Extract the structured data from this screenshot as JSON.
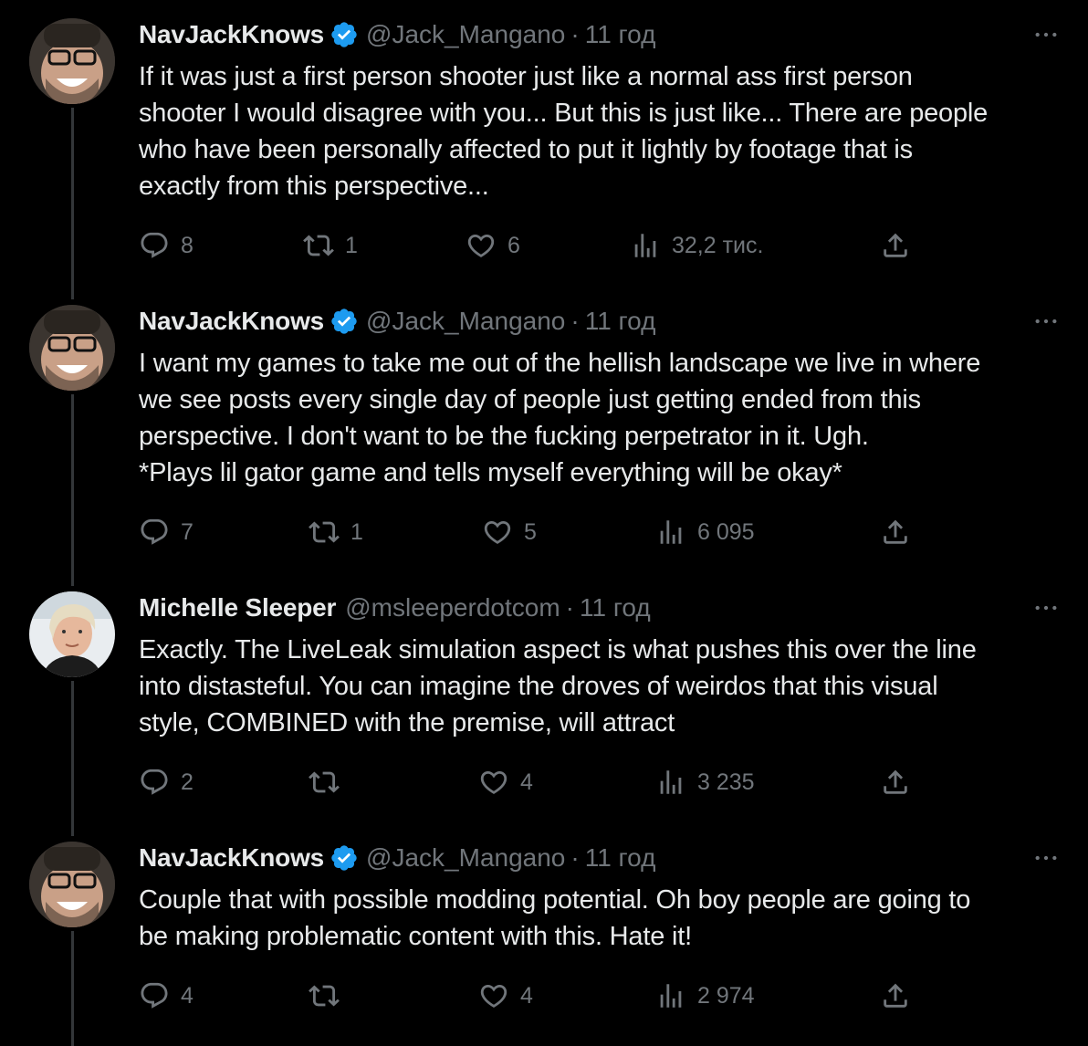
{
  "tweets": [
    {
      "name": "NavJackKnows",
      "verified": true,
      "handle": "@Jack_Mangano",
      "separator": "·",
      "time": "11 год",
      "text": "If it was just a first person shooter just like a normal ass first person\nshooter I would disagree with you... But this is just like... There are people\nwho have been personally affected to put it lightly by footage that is\nexactly from this perspective...",
      "replies": "8",
      "retweets": "1",
      "likes": "6",
      "views": "32,2 тис.",
      "avatar": "avatar-navjack"
    },
    {
      "name": "NavJackKnows",
      "verified": true,
      "handle": "@Jack_Mangano",
      "separator": "·",
      "time": "11 год",
      "text": "I want my games to take me out of the hellish landscape we live in where\nwe see posts every single day of people just getting ended from this\nperspective. I don't want to be the fucking perpetrator in it. Ugh.\n*Plays lil gator game and tells myself everything will be okay*",
      "replies": "7",
      "retweets": "1",
      "likes": "5",
      "views": "6 095",
      "avatar": "avatar-navjack"
    },
    {
      "name": "Michelle Sleeper",
      "verified": false,
      "handle": "@msleeperdotcom",
      "separator": "·",
      "time": "11 год",
      "text": "Exactly. The LiveLeak simulation aspect is what pushes this over the line\ninto distasteful. You can imagine the droves of weirdos that this visual\nstyle, COMBINED with the premise, will attract",
      "replies": "2",
      "retweets": "",
      "likes": "4",
      "views": "3 235",
      "avatar": "avatar-michelle"
    },
    {
      "name": "NavJackKnows",
      "verified": true,
      "handle": "@Jack_Mangano",
      "separator": "·",
      "time": "11 год",
      "text": "Couple that with possible modding potential. Oh boy people are going to\nbe making problematic content with this. Hate it!",
      "replies": "4",
      "retweets": "",
      "likes": "4",
      "views": "2 974",
      "avatar": "avatar-navjack"
    }
  ],
  "colors": {
    "background": "#000000",
    "text": "#e7e9ea",
    "muted": "#71767b",
    "verified": "#1d9bf0",
    "thread_line": "#333639"
  },
  "icons": [
    "reply-icon",
    "retweet-icon",
    "like-icon",
    "views-icon",
    "share-icon",
    "more-icon",
    "verified-badge-icon"
  ]
}
